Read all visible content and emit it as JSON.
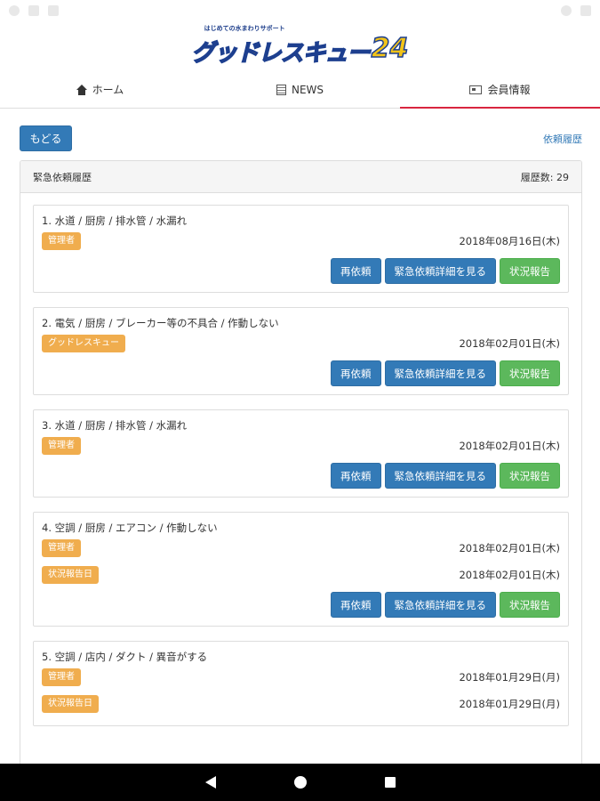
{
  "header": {
    "logo_tagline": "はじめての水まわりサポート",
    "logo_text": "グッドレスキュー",
    "logo_number": "24"
  },
  "nav": {
    "tabs": [
      {
        "label": "ホーム",
        "icon": "home-icon"
      },
      {
        "label": "NEWS",
        "icon": "news-icon"
      },
      {
        "label": "会員情報",
        "icon": "member-card-icon",
        "active": true
      }
    ]
  },
  "toolbar": {
    "back_label": "もどる",
    "history_link": "依頼履歴"
  },
  "panel": {
    "title": "緊急依頼履歴",
    "count_label": "履歴数: 29"
  },
  "buttons": {
    "rerequest": "再依頼",
    "details": "緊急依頼詳細を見る",
    "status_report": "状況報告"
  },
  "items": [
    {
      "title": "1. 水道 / 厨房 / 排水管 / 水漏れ",
      "badges": [
        {
          "label": "管理者",
          "date": "2018年08月16日(木)"
        }
      ]
    },
    {
      "title": "2. 電気 / 厨房 / ブレーカー等の不具合 / 作動しない",
      "badges": [
        {
          "label": "グッドレスキュー",
          "date": "2018年02月01日(木)"
        }
      ]
    },
    {
      "title": "3. 水道 / 厨房 / 排水管 / 水漏れ",
      "badges": [
        {
          "label": "管理者",
          "date": "2018年02月01日(木)"
        }
      ]
    },
    {
      "title": "4. 空調 / 厨房 / エアコン / 作動しない",
      "badges": [
        {
          "label": "管理者",
          "date": "2018年02月01日(木)"
        },
        {
          "label": "状況報告日",
          "date": "2018年02月01日(木)"
        }
      ]
    },
    {
      "title": "5. 空調 / 店内 / ダクト / 異音がする",
      "badges": [
        {
          "label": "管理者",
          "date": "2018年01月29日(月)"
        },
        {
          "label": "状況報告日",
          "date": "2018年01月29日(月)"
        }
      ]
    }
  ],
  "colors": {
    "primary": "#337ab7",
    "success": "#5cb85c",
    "warning": "#f0ad4e",
    "active_tab": "#d9263f"
  }
}
